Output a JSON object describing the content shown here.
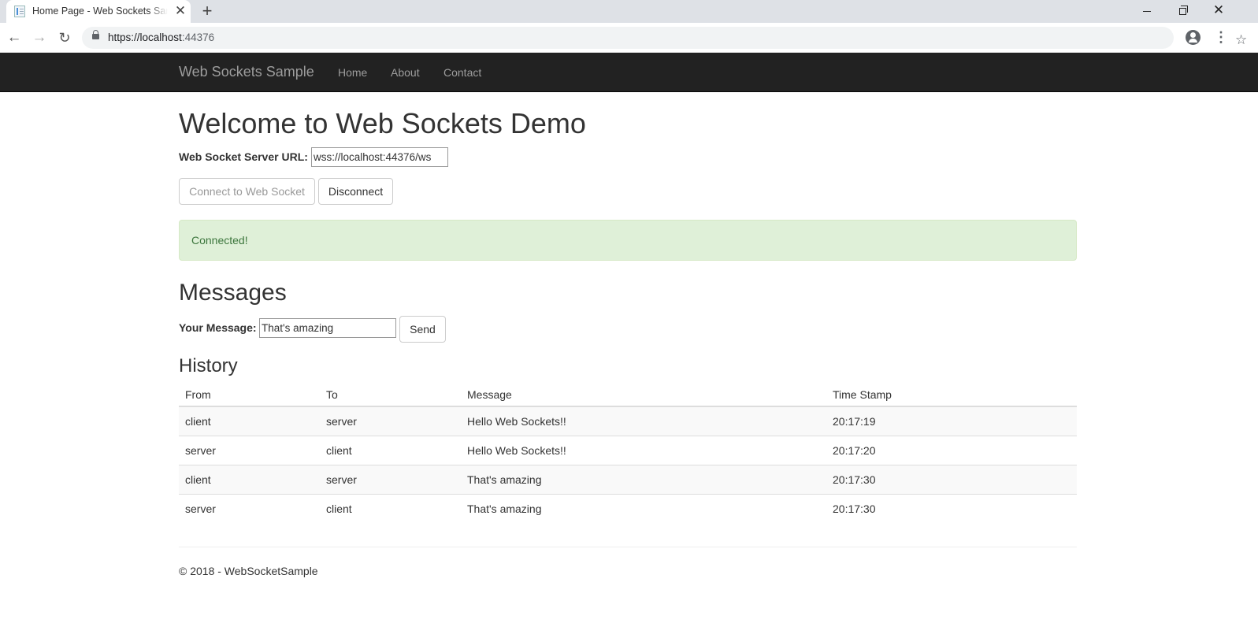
{
  "browser": {
    "tab_title": "Home Page - Web Sockets Sample",
    "url_host": "https://localhost",
    "url_port": ":44376",
    "new_tab_glyph": "+",
    "close_glyph": "✕"
  },
  "navbar": {
    "brand": "Web Sockets Sample",
    "links": [
      "Home",
      "About",
      "Contact"
    ]
  },
  "page": {
    "heading": "Welcome to Web Sockets Demo",
    "server_url_label": "Web Socket Server URL:",
    "server_url_value": "wss://localhost:44376/ws",
    "connect_button": "Connect to Web Socket",
    "disconnect_button": "Disconnect",
    "alert_text": "Connected!",
    "messages_heading": "Messages",
    "message_label": "Your Message:",
    "message_value": "That's amazing",
    "send_button": "Send",
    "history_heading": "History",
    "footer": "© 2018 - WebSocketSample"
  },
  "history": {
    "columns": [
      "From",
      "To",
      "Message",
      "Time Stamp"
    ],
    "rows": [
      [
        "client",
        "server",
        "Hello Web Sockets!!",
        "20:17:19"
      ],
      [
        "server",
        "client",
        "Hello Web Sockets!!",
        "20:17:20"
      ],
      [
        "client",
        "server",
        "That's amazing",
        "20:17:30"
      ],
      [
        "server",
        "client",
        "That's amazing",
        "20:17:30"
      ]
    ]
  },
  "colors": {
    "navbar_bg": "#222222",
    "alert_bg": "#dff0d8",
    "alert_text": "#3c763d"
  }
}
